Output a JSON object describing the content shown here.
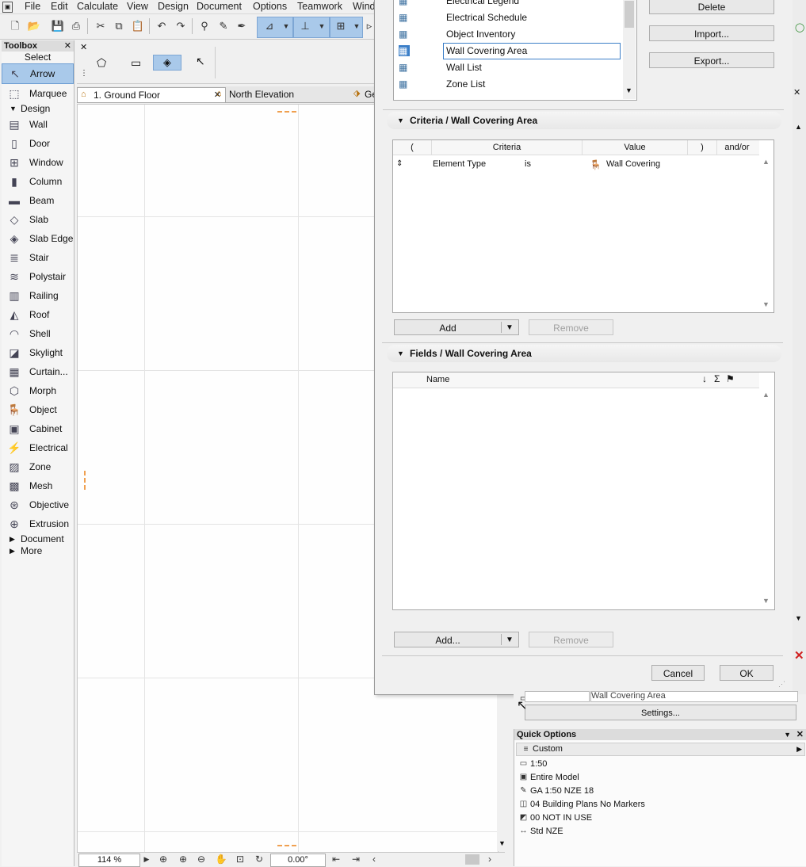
{
  "menu": [
    "File",
    "Edit",
    "Calculate",
    "View",
    "Design",
    "Document",
    "Options",
    "Teamwork",
    "Wind"
  ],
  "toolbox": {
    "title": "Toolbox",
    "select_label": "Select",
    "arrow": "Arrow",
    "marquee": "Marquee",
    "design_group": "Design",
    "tools": [
      "Wall",
      "Door",
      "Window",
      "Column",
      "Beam",
      "Slab",
      "Slab Edge",
      "Stair",
      "Polystair",
      "Railing",
      "Roof",
      "Shell",
      "Skylight",
      "Curtain...",
      "Morph",
      "Object",
      "Cabinet",
      "Electrical",
      "Zone",
      "Mesh",
      "Objective",
      "Extrusion"
    ],
    "document_group": "Document",
    "more_group": "More"
  },
  "tabs": {
    "ground_floor": "1. Ground Floor",
    "north_elevation": "North Elevation",
    "third": "Ge"
  },
  "statusbar": {
    "zoom": "114 %",
    "angle": "0.00°"
  },
  "dialog": {
    "schemes": [
      {
        "label": "Electrical Legend",
        "selected": false
      },
      {
        "label": "Electrical Schedule",
        "selected": false
      },
      {
        "label": "Object Inventory",
        "selected": false
      },
      {
        "label": "Wall Covering Area",
        "selected": true
      },
      {
        "label": "Wall List",
        "selected": false
      },
      {
        "label": "Zone List",
        "selected": false
      }
    ],
    "buttons": {
      "delete": "Delete",
      "import": "Import...",
      "export": "Export..."
    },
    "criteria": {
      "section_title": "Criteria /  Wall Covering Area",
      "columns": {
        "open_paren": "(",
        "criteria": "Criteria",
        "value": "Value",
        "close_paren": ")",
        "and_or": "and/or"
      },
      "rows": [
        {
          "criteria": "Element Type",
          "operator": "is",
          "value": "Wall Covering"
        }
      ],
      "add": "Add",
      "remove": "Remove"
    },
    "fields": {
      "section_title": "Fields /  Wall Covering Area",
      "name_column": "Name",
      "add": "Add...",
      "remove": "Remove"
    },
    "cancel": "Cancel",
    "ok": "OK"
  },
  "navigator": {
    "name_value": "Wall Covering Area",
    "settings": "Settings..."
  },
  "quick_options": {
    "title": "Quick Options",
    "custom": "Custom",
    "items": [
      {
        "label": "1:50",
        "icon": "scale-icon"
      },
      {
        "label": "Entire Model",
        "icon": "model-view-icon"
      },
      {
        "label": "GA 1:50 NZE 18",
        "icon": "pen-set-icon"
      },
      {
        "label": "04 Building Plans No Markers",
        "icon": "layer-combination-icon"
      },
      {
        "label": "00 NOT IN USE",
        "icon": "model-view-options-icon"
      },
      {
        "label": "Std NZE",
        "icon": "dimension-icon"
      }
    ]
  }
}
